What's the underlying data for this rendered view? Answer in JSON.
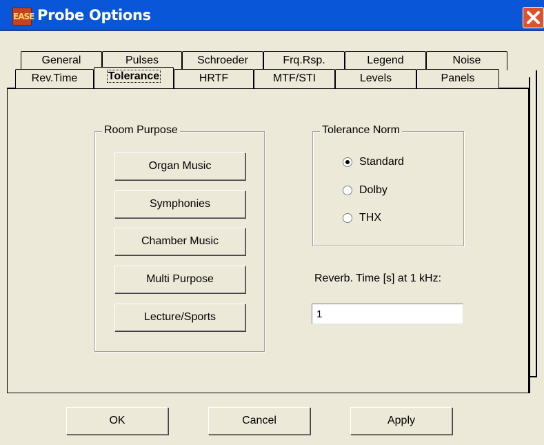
{
  "window": {
    "title": "Probe Options",
    "icon_text": "EASE"
  },
  "tabs_back": [
    {
      "label": "General"
    },
    {
      "label": "Pulses"
    },
    {
      "label": "Schroeder"
    },
    {
      "label": "Frq.Rsp."
    },
    {
      "label": "Legend"
    },
    {
      "label": "Noise"
    }
  ],
  "tabs_front": [
    {
      "label": "Rev.Time"
    },
    {
      "label": "Tolerance",
      "active": true
    },
    {
      "label": "HRTF"
    },
    {
      "label": "MTF/STI"
    },
    {
      "label": "Levels"
    },
    {
      "label": "Panels"
    }
  ],
  "room_purpose": {
    "legend": "Room Purpose",
    "buttons": [
      "Organ Music",
      "Symphonies",
      "Chamber Music",
      "Multi Purpose",
      "Lecture/Sports"
    ]
  },
  "tolerance_norm": {
    "legend": "Tolerance Norm",
    "options": [
      {
        "label": "Standard",
        "selected": true
      },
      {
        "label": "Dolby",
        "selected": false
      },
      {
        "label": "THX",
        "selected": false
      }
    ]
  },
  "reverb": {
    "label": "Reverb. Time [s] at 1 kHz:",
    "value": "1"
  },
  "footer": {
    "ok": "OK",
    "cancel": "Cancel",
    "apply": "Apply"
  },
  "colors": {
    "titlebar": "#0a56d8",
    "close": "#e0502d",
    "dialog": "#ece9d8"
  }
}
